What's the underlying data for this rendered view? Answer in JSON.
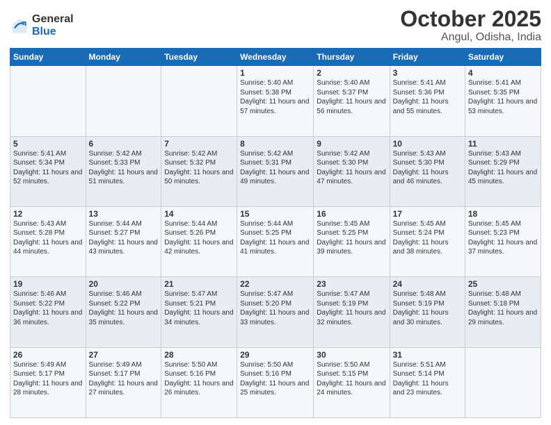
{
  "logo": {
    "general": "General",
    "blue": "Blue"
  },
  "header": {
    "month": "October 2025",
    "location": "Angul, Odisha, India"
  },
  "weekdays": [
    "Sunday",
    "Monday",
    "Tuesday",
    "Wednesday",
    "Thursday",
    "Friday",
    "Saturday"
  ],
  "weeks": [
    [
      {
        "day": "",
        "sunrise": "",
        "sunset": "",
        "daylight": ""
      },
      {
        "day": "",
        "sunrise": "",
        "sunset": "",
        "daylight": ""
      },
      {
        "day": "",
        "sunrise": "",
        "sunset": "",
        "daylight": ""
      },
      {
        "day": "1",
        "sunrise": "Sunrise: 5:40 AM",
        "sunset": "Sunset: 5:38 PM",
        "daylight": "Daylight: 11 hours and 57 minutes."
      },
      {
        "day": "2",
        "sunrise": "Sunrise: 5:40 AM",
        "sunset": "Sunset: 5:37 PM",
        "daylight": "Daylight: 11 hours and 56 minutes."
      },
      {
        "day": "3",
        "sunrise": "Sunrise: 5:41 AM",
        "sunset": "Sunset: 5:36 PM",
        "daylight": "Daylight: 11 hours and 55 minutes."
      },
      {
        "day": "4",
        "sunrise": "Sunrise: 5:41 AM",
        "sunset": "Sunset: 5:35 PM",
        "daylight": "Daylight: 11 hours and 53 minutes."
      }
    ],
    [
      {
        "day": "5",
        "sunrise": "Sunrise: 5:41 AM",
        "sunset": "Sunset: 5:34 PM",
        "daylight": "Daylight: 11 hours and 52 minutes."
      },
      {
        "day": "6",
        "sunrise": "Sunrise: 5:42 AM",
        "sunset": "Sunset: 5:33 PM",
        "daylight": "Daylight: 11 hours and 51 minutes."
      },
      {
        "day": "7",
        "sunrise": "Sunrise: 5:42 AM",
        "sunset": "Sunset: 5:32 PM",
        "daylight": "Daylight: 11 hours and 50 minutes."
      },
      {
        "day": "8",
        "sunrise": "Sunrise: 5:42 AM",
        "sunset": "Sunset: 5:31 PM",
        "daylight": "Daylight: 11 hours and 49 minutes."
      },
      {
        "day": "9",
        "sunrise": "Sunrise: 5:42 AM",
        "sunset": "Sunset: 5:30 PM",
        "daylight": "Daylight: 11 hours and 47 minutes."
      },
      {
        "day": "10",
        "sunrise": "Sunrise: 5:43 AM",
        "sunset": "Sunset: 5:30 PM",
        "daylight": "Daylight: 11 hours and 46 minutes."
      },
      {
        "day": "11",
        "sunrise": "Sunrise: 5:43 AM",
        "sunset": "Sunset: 5:29 PM",
        "daylight": "Daylight: 11 hours and 45 minutes."
      }
    ],
    [
      {
        "day": "12",
        "sunrise": "Sunrise: 5:43 AM",
        "sunset": "Sunset: 5:28 PM",
        "daylight": "Daylight: 11 hours and 44 minutes."
      },
      {
        "day": "13",
        "sunrise": "Sunrise: 5:44 AM",
        "sunset": "Sunset: 5:27 PM",
        "daylight": "Daylight: 11 hours and 43 minutes."
      },
      {
        "day": "14",
        "sunrise": "Sunrise: 5:44 AM",
        "sunset": "Sunset: 5:26 PM",
        "daylight": "Daylight: 11 hours and 42 minutes."
      },
      {
        "day": "15",
        "sunrise": "Sunrise: 5:44 AM",
        "sunset": "Sunset: 5:25 PM",
        "daylight": "Daylight: 11 hours and 41 minutes."
      },
      {
        "day": "16",
        "sunrise": "Sunrise: 5:45 AM",
        "sunset": "Sunset: 5:25 PM",
        "daylight": "Daylight: 11 hours and 39 minutes."
      },
      {
        "day": "17",
        "sunrise": "Sunrise: 5:45 AM",
        "sunset": "Sunset: 5:24 PM",
        "daylight": "Daylight: 11 hours and 38 minutes."
      },
      {
        "day": "18",
        "sunrise": "Sunrise: 5:45 AM",
        "sunset": "Sunset: 5:23 PM",
        "daylight": "Daylight: 11 hours and 37 minutes."
      }
    ],
    [
      {
        "day": "19",
        "sunrise": "Sunrise: 5:46 AM",
        "sunset": "Sunset: 5:22 PM",
        "daylight": "Daylight: 11 hours and 36 minutes."
      },
      {
        "day": "20",
        "sunrise": "Sunrise: 5:46 AM",
        "sunset": "Sunset: 5:22 PM",
        "daylight": "Daylight: 11 hours and 35 minutes."
      },
      {
        "day": "21",
        "sunrise": "Sunrise: 5:47 AM",
        "sunset": "Sunset: 5:21 PM",
        "daylight": "Daylight: 11 hours and 34 minutes."
      },
      {
        "day": "22",
        "sunrise": "Sunrise: 5:47 AM",
        "sunset": "Sunset: 5:20 PM",
        "daylight": "Daylight: 11 hours and 33 minutes."
      },
      {
        "day": "23",
        "sunrise": "Sunrise: 5:47 AM",
        "sunset": "Sunset: 5:19 PM",
        "daylight": "Daylight: 11 hours and 32 minutes."
      },
      {
        "day": "24",
        "sunrise": "Sunrise: 5:48 AM",
        "sunset": "Sunset: 5:19 PM",
        "daylight": "Daylight: 11 hours and 30 minutes."
      },
      {
        "day": "25",
        "sunrise": "Sunrise: 5:48 AM",
        "sunset": "Sunset: 5:18 PM",
        "daylight": "Daylight: 11 hours and 29 minutes."
      }
    ],
    [
      {
        "day": "26",
        "sunrise": "Sunrise: 5:49 AM",
        "sunset": "Sunset: 5:17 PM",
        "daylight": "Daylight: 11 hours and 28 minutes."
      },
      {
        "day": "27",
        "sunrise": "Sunrise: 5:49 AM",
        "sunset": "Sunset: 5:17 PM",
        "daylight": "Daylight: 11 hours and 27 minutes."
      },
      {
        "day": "28",
        "sunrise": "Sunrise: 5:50 AM",
        "sunset": "Sunset: 5:16 PM",
        "daylight": "Daylight: 11 hours and 26 minutes."
      },
      {
        "day": "29",
        "sunrise": "Sunrise: 5:50 AM",
        "sunset": "Sunset: 5:16 PM",
        "daylight": "Daylight: 11 hours and 25 minutes."
      },
      {
        "day": "30",
        "sunrise": "Sunrise: 5:50 AM",
        "sunset": "Sunset: 5:15 PM",
        "daylight": "Daylight: 11 hours and 24 minutes."
      },
      {
        "day": "31",
        "sunrise": "Sunrise: 5:51 AM",
        "sunset": "Sunset: 5:14 PM",
        "daylight": "Daylight: 11 hours and 23 minutes."
      },
      {
        "day": "",
        "sunrise": "",
        "sunset": "",
        "daylight": ""
      }
    ]
  ]
}
